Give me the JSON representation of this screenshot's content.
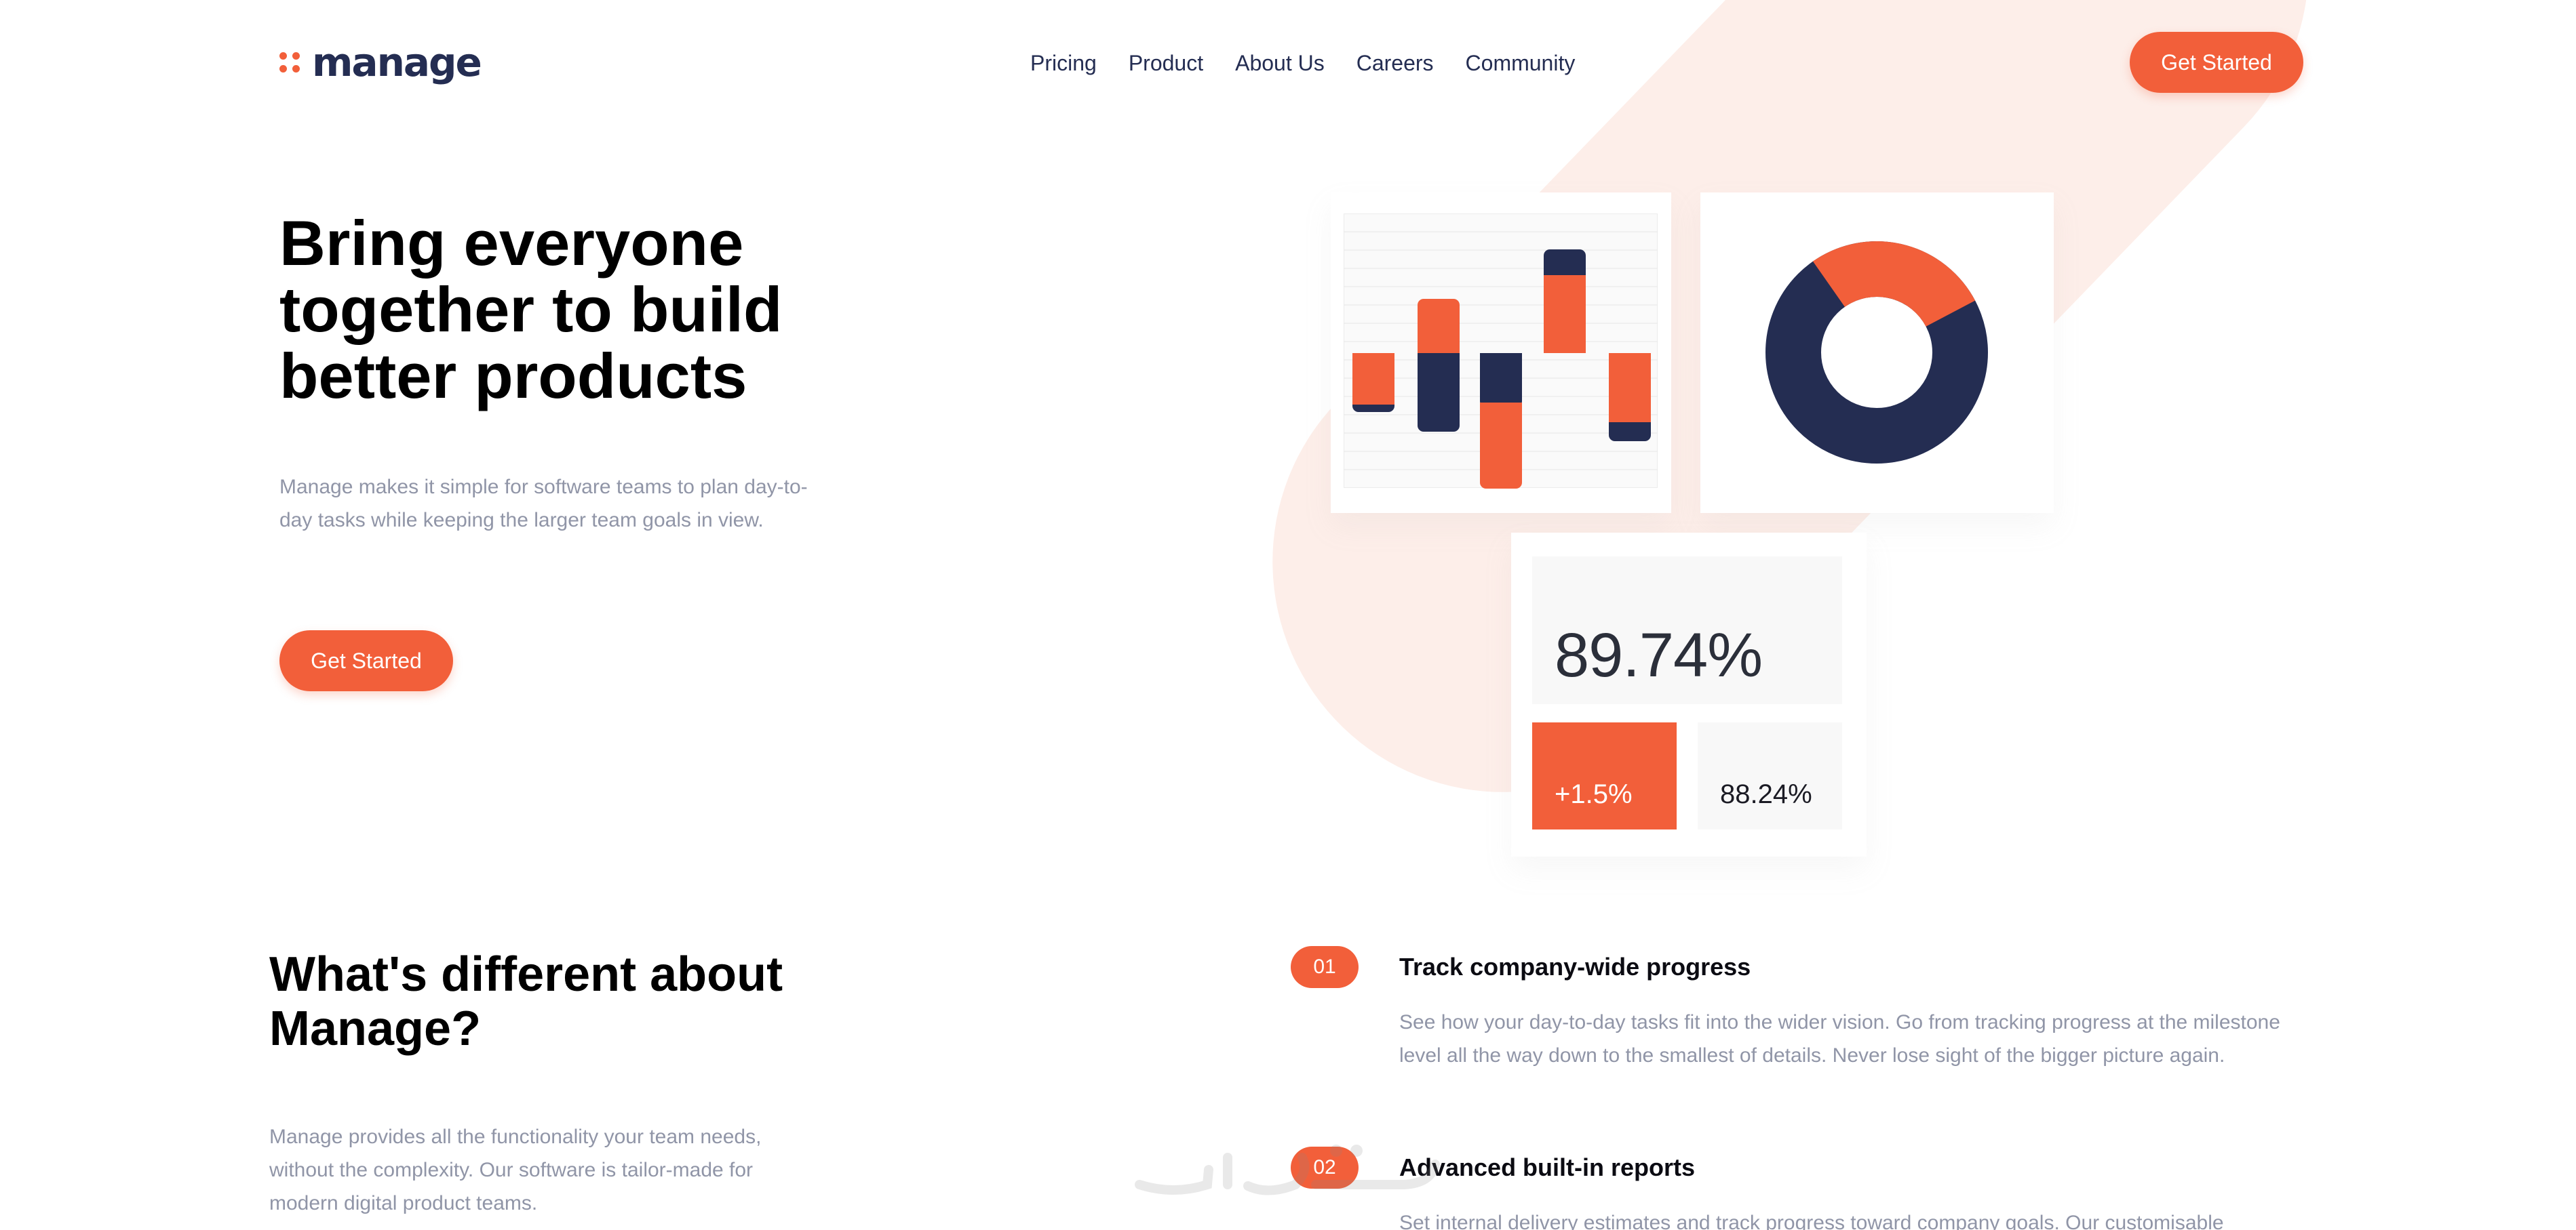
{
  "header": {
    "logo_text": "manage",
    "nav": [
      "Pricing",
      "Product",
      "About Us",
      "Careers",
      "Community"
    ],
    "cta_label": "Get Started"
  },
  "hero": {
    "title": "Bring everyone together to build better products",
    "description": "Manage makes it simple for software teams to plan day-to-day tasks while keeping the larger team goals in view.",
    "cta_label": "Get Started"
  },
  "illustration": {
    "stat_main": "89.74%",
    "stat_change": "+1.5%",
    "stat_secondary": "88.24%",
    "donut_orange_fraction": 0.27,
    "colors": {
      "accent": "#f25f3a",
      "navy": "#242d52",
      "tint": "#fdeee9"
    }
  },
  "section_different": {
    "title": "What's different about Manage?",
    "description": "Manage provides all the functionality your team needs, without the complexity. Our software is tailor-made for modern digital product teams."
  },
  "features": [
    {
      "num": "01",
      "title": "Track company-wide progress",
      "description": "See how your day-to-day tasks fit into the wider vision. Go from tracking progress at the milestone level all the way down to the smallest of details. Never lose sight of the bigger picture again."
    },
    {
      "num": "02",
      "title": "Advanced built-in reports",
      "description": "Set internal delivery estimates and track progress toward company goals. Our customisable"
    }
  ]
}
